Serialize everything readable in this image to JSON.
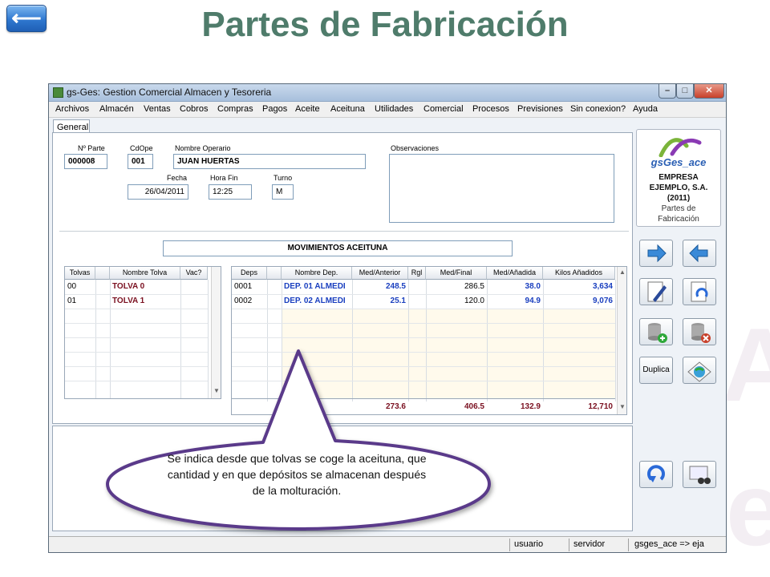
{
  "slide": {
    "back_arrow": "⟵",
    "title": "Partes de Fabricación"
  },
  "window": {
    "title": "gs-Ges: Gestion Comercial Almacen y Tesoreria",
    "menu": [
      "Archivos",
      "Almacén",
      "Ventas",
      "Cobros",
      "Compras",
      "Pagos",
      "Aceite",
      "Aceituna",
      "Utilidades",
      "Comercial",
      "Procesos",
      "Previsiones",
      "Sin conexion?",
      "Ayuda"
    ],
    "tab": "General"
  },
  "form": {
    "parte_label": "Nº Parte",
    "parte_value": "000008",
    "cdope_label": "CdOpe",
    "cdope_value": "001",
    "operario_label": "Nombre Operario",
    "operario_value": "JUAN HUERTAS",
    "fecha_label": "Fecha",
    "fecha_value": "26/04/2011",
    "horafin_label": "Hora Fin",
    "horafin_value": "12:25",
    "turno_label": "Turno",
    "turno_value": "M",
    "observaciones_label": "Observaciones"
  },
  "section_title": "MOVIMIENTOS ACEITUNA",
  "tolvas": {
    "headers": [
      "Tolvas",
      "Nombre Tolva",
      "Vac?"
    ],
    "rows": [
      {
        "code": "00",
        "name": "TOLVA 0"
      },
      {
        "code": "01",
        "name": "TOLVA 1"
      }
    ]
  },
  "depositos": {
    "headers": [
      "Deps",
      "Nombre Dep.",
      "Med/Anterior",
      "Rgl",
      "Med/Final",
      "Med/Añadida",
      "Kilos Añadidos"
    ],
    "rows": [
      {
        "code": "0001",
        "name": "DEP. 01 ALMEDI",
        "anterior": "248.5",
        "final": "286.5",
        "anadida": "38.0",
        "kilos": "3,634"
      },
      {
        "code": "0002",
        "name": "DEP. 02 ALMEDI",
        "anterior": "25.1",
        "final": "120.0",
        "anadida": "94.9",
        "kilos": "9,076"
      }
    ],
    "totals": {
      "anterior": "273.6",
      "final": "406.5",
      "anadida": "132.9",
      "kilos": "12,710"
    }
  },
  "logo": {
    "brand": "gsGes_ace",
    "company": "EMPRESA EJEMPLO, S.A. (2011)",
    "module": "Partes de Fabricación"
  },
  "buttons": {
    "duplica": "Duplica"
  },
  "status": {
    "user": "usuario",
    "server": "servidor",
    "db": "gsges_ace => eja"
  },
  "callout": "Se indica desde que tolvas se coge la aceituna, que cantidad y en que depósitos se almacenan después de la molturación.",
  "colors": {
    "title": "#4f7c6b",
    "accent_blue": "#1a3fbf",
    "dark_red": "#7a1020",
    "callout_border": "#5a3a8a"
  }
}
